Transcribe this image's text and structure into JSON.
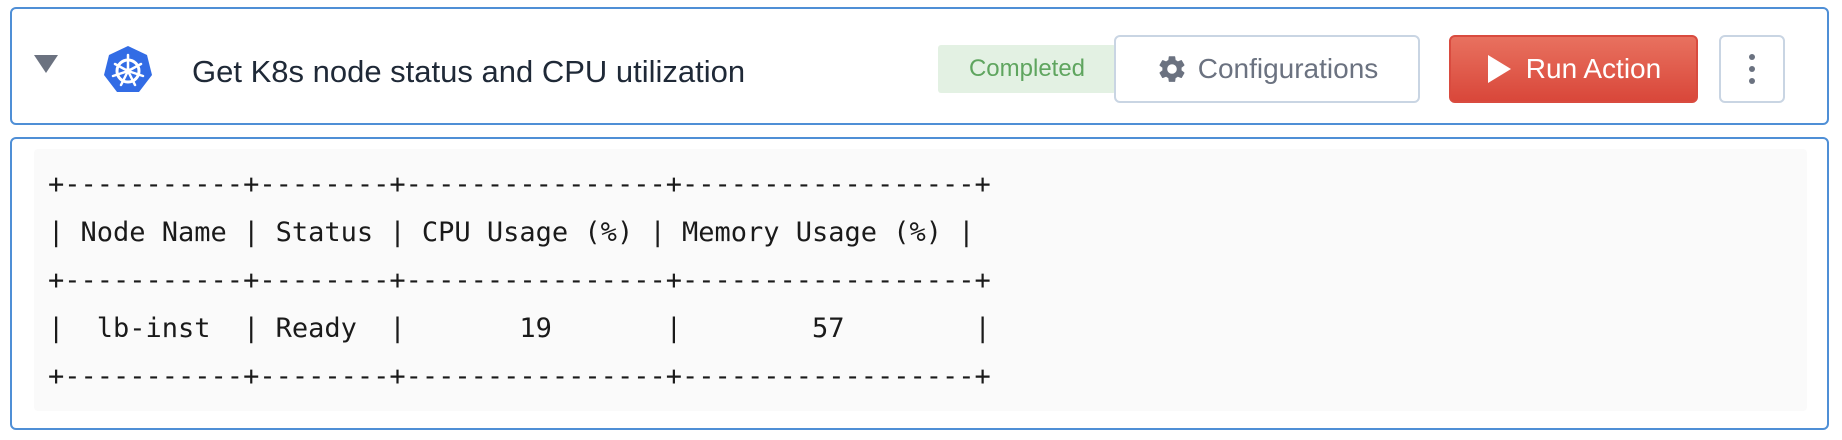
{
  "action": {
    "title": "Get K8s node status and CPU utilization",
    "status": "Completed",
    "logo_icon": "kubernetes-icon",
    "collapse_icon": "triangle-down-icon"
  },
  "toolbar": {
    "configurations_label": "Configurations",
    "configurations_icon": "gear-icon",
    "run_label": "Run Action",
    "run_icon": "play-icon",
    "more_icon": "vertical-ellipsis-icon"
  },
  "colors": {
    "accent_border": "#4f8fd6",
    "run_button": "#d9473a",
    "status_bg": "#e3f1e3",
    "status_text": "#5fa55f",
    "k8s_blue": "#326ce5"
  },
  "output": {
    "lines": [
      "+-----------+--------+----------------+------------------+",
      "| Node Name | Status | CPU Usage (%) | Memory Usage (%) |",
      "+-----------+--------+----------------+------------------+",
      "|  lb-inst  | Ready  |       19       |        57        |",
      "+-----------+--------+----------------+------------------+"
    ]
  }
}
